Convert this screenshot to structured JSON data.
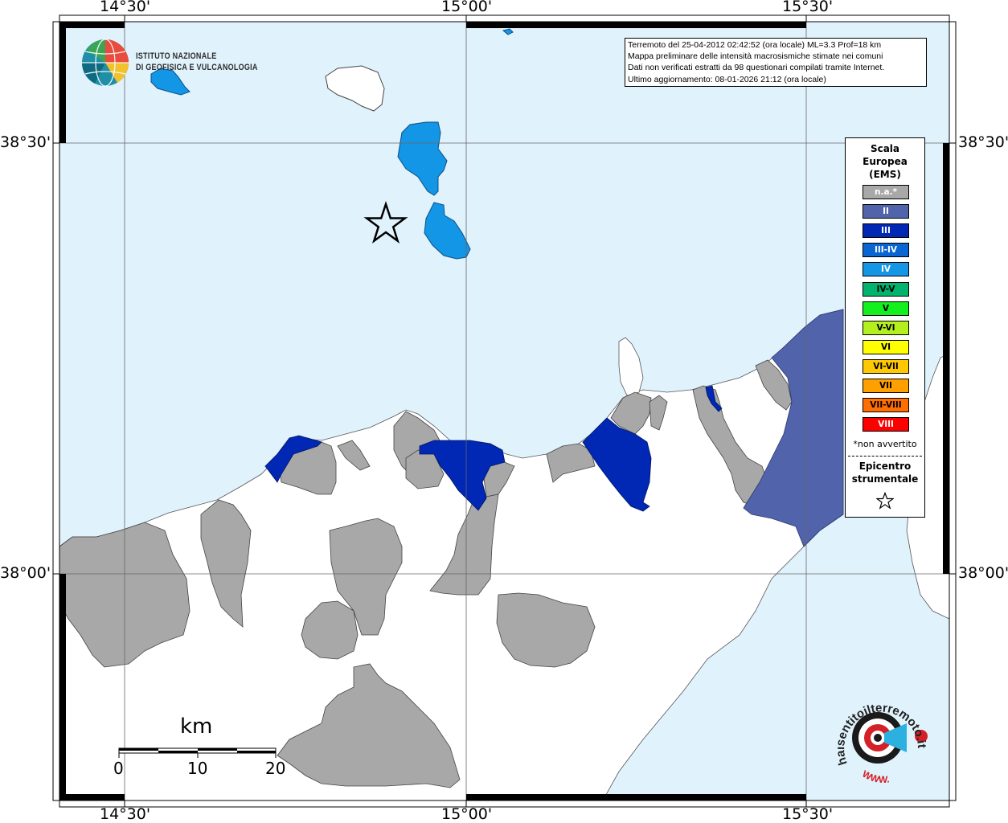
{
  "institute": {
    "name_line1": "ISTITUTO NAZIONALE",
    "name_line2": "DI GEOFISICA E VULCANOLOGIA"
  },
  "info_box": {
    "line1": "Terremoto del 25-04-2012 02:42:52 (ora locale) ML=3.3 Prof=18 km",
    "line2": "Mappa preliminare delle intensità macrosismiche stimate nei comuni",
    "line3": "Dati non verificati estratti da 98 questionari compilati tramite Internet.",
    "line4": "Ultimo aggiornamento: 08-01-2026 21:12 (ora locale)"
  },
  "coordinates": {
    "lon_left": "14°30'",
    "lon_mid": "15°00'",
    "lon_right": "15°30'",
    "lat_top": "38°30'",
    "lat_bottom": "38°00'"
  },
  "legend": {
    "title_line1": "Scala",
    "title_line2": "Europea",
    "title_line3": "(EMS)",
    "classes": [
      {
        "label": "n.a.*",
        "color": "#a8a8a8",
        "text_color": "#ffffff"
      },
      {
        "label": "II",
        "color": "#5164ab",
        "text_color": "#ffffff"
      },
      {
        "label": "III",
        "color": "#0028b4",
        "text_color": "#ffffff"
      },
      {
        "label": "III-IV",
        "color": "#0a64d2",
        "text_color": "#ffffff"
      },
      {
        "label": "IV",
        "color": "#1496e6",
        "text_color": "#ffffff"
      },
      {
        "label": "IV-V",
        "color": "#00b46e",
        "text_color": "#000000"
      },
      {
        "label": "V",
        "color": "#14f01e",
        "text_color": "#000000"
      },
      {
        "label": "V-VI",
        "color": "#b4f01e",
        "text_color": "#000000"
      },
      {
        "label": "VI",
        "color": "#ffff00",
        "text_color": "#000000"
      },
      {
        "label": "VI-VII",
        "color": "#ffc800",
        "text_color": "#000000"
      },
      {
        "label": "VII",
        "color": "#ffa000",
        "text_color": "#000000"
      },
      {
        "label": "VII-VIII",
        "color": "#ff6e00",
        "text_color": "#000000"
      },
      {
        "label": "VIII",
        "color": "#ff0000",
        "text_color": "#ffffff"
      }
    ],
    "na_note": "*non avvertito",
    "epicenter_line1": "Epicentro",
    "epicenter_line2": "strumentale"
  },
  "scale_bar": {
    "unit": "km",
    "tick0": "0",
    "tick10": "10",
    "tick20": "20"
  },
  "site_logo": {
    "text_main": "haisentitoilterremoto.it",
    "text_www": "WWW."
  },
  "colors": {
    "sea": "#e0f2fc",
    "land": "#ffffff",
    "not_felt": "#a8a8a8",
    "ems_ii": "#5164ab",
    "ems_iii": "#0028b4",
    "ems_iv": "#1496e6",
    "logo_red": "#d42027"
  }
}
